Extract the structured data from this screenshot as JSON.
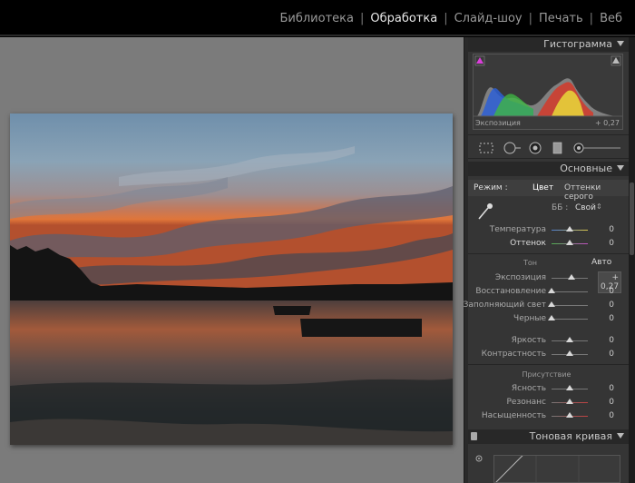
{
  "modules": [
    {
      "label": "Библиотека",
      "active": false
    },
    {
      "label": "Обработка",
      "active": true
    },
    {
      "label": "Слайд-шоу",
      "active": false
    },
    {
      "label": "Печать",
      "active": false
    },
    {
      "label": "Веб",
      "active": false
    }
  ],
  "histogram": {
    "title": "Гистограмма",
    "label": "Экспозиция",
    "value": "+ 0,27"
  },
  "basic": {
    "title": "Основные",
    "mode_label": "Режим :",
    "mode_color": "Цвет",
    "mode_gray": "Оттенки серого",
    "wb_label": "ББ :",
    "wb_value": "Свой",
    "temperature": {
      "label": "Температура",
      "value": "0",
      "level": 0.5
    },
    "tint": {
      "label": "Оттенок",
      "value": "0",
      "level": 0.5
    },
    "tone_title": "Тон",
    "auto_label": "Авто",
    "exposure": {
      "label": "Экспозиция",
      "value": "+ 0,27",
      "level": 0.55
    },
    "recovery": {
      "label": "Восстановление",
      "value": "0",
      "level": 0.0
    },
    "fill_light": {
      "label": "Заполняющий свет",
      "value": "0",
      "level": 0.0
    },
    "blacks": {
      "label": "Черные",
      "value": "0",
      "level": 0.0
    },
    "brightness": {
      "label": "Яркость",
      "value": "0",
      "level": 0.5
    },
    "contrast": {
      "label": "Контрастность",
      "value": "0",
      "level": 0.5
    },
    "presence_title": "Присутствие",
    "clarity": {
      "label": "Ясность",
      "value": "0",
      "level": 0.5
    },
    "vibrance": {
      "label": "Резонанс",
      "value": "0",
      "level": 0.5
    },
    "saturation": {
      "label": "Насыщенность",
      "value": "0",
      "level": 0.5
    }
  },
  "tone_curve": {
    "title": "Тоновая кривая"
  },
  "colors": {
    "canvas": "#7b7b7b",
    "panel": "#353535",
    "active_module": "#e8e8e8"
  },
  "icons": [
    "crop-icon",
    "spot-removal-icon",
    "red-eye-icon",
    "graduated-filter-icon",
    "adjustment-brush-icon",
    "eyedropper-icon"
  ]
}
